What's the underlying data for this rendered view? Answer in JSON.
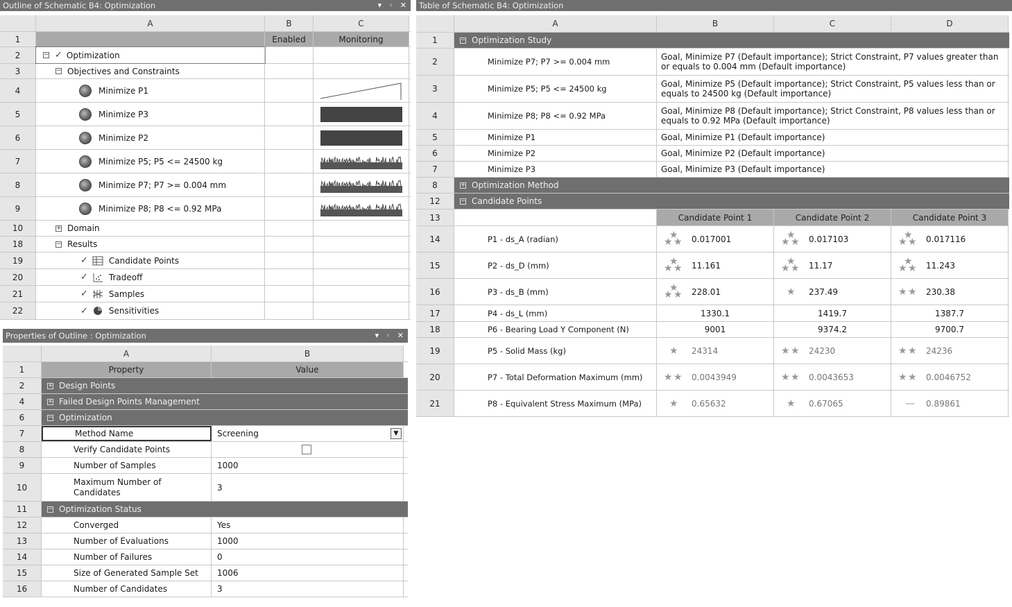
{
  "outline": {
    "title": "Outline of Schematic B4: Optimization",
    "controls": [
      "▾",
      "ᚲ",
      "✕"
    ],
    "col_headers": [
      "A",
      "B",
      "C"
    ],
    "subheaders": {
      "b": "Enabled",
      "c": "Monitoring"
    },
    "rows": [
      {
        "num": "1"
      },
      {
        "num": "2",
        "label": "Optimization",
        "toggle": "−",
        "check": "✓"
      },
      {
        "num": "3",
        "label": "Objectives and Constraints",
        "toggle": "−"
      },
      {
        "num": "4",
        "label": "Minimize P1",
        "spark": "line"
      },
      {
        "num": "5",
        "label": "Minimize P3",
        "spark": "dense"
      },
      {
        "num": "6",
        "label": "Minimize P2",
        "spark": "dense"
      },
      {
        "num": "7",
        "label": "Minimize P5; P5 <= 24500 kg",
        "spark": "noisy"
      },
      {
        "num": "8",
        "label": "Minimize P7; P7 >= 0.004 mm",
        "spark": "noisy"
      },
      {
        "num": "9",
        "label": "Minimize P8; P8 <= 0.92 MPa",
        "spark": "noisy"
      },
      {
        "num": "10",
        "label": "Domain",
        "toggle": "+"
      },
      {
        "num": "18",
        "label": "Results",
        "toggle": "−"
      },
      {
        "num": "19",
        "label": "Candidate Points",
        "check": "✓",
        "icon": "table-icon"
      },
      {
        "num": "20",
        "label": "Tradeoff",
        "check": "✓",
        "icon": "scatter-icon"
      },
      {
        "num": "21",
        "label": "Samples",
        "check": "✓",
        "icon": "samples-icon"
      },
      {
        "num": "22",
        "label": "Sensitivities",
        "check": "✓",
        "icon": "sensitivity-icon"
      }
    ]
  },
  "properties": {
    "title": "Properties of Outline : Optimization",
    "controls": [
      "▾",
      "ᚲ",
      "✕"
    ],
    "col_headers": [
      "A",
      "B"
    ],
    "subheaders": {
      "a": "Property",
      "b": "Value"
    },
    "rows": [
      {
        "num": "2",
        "section": true,
        "toggle": "+",
        "label": "Design Points"
      },
      {
        "num": "4",
        "section": true,
        "toggle": "+",
        "label": "Failed Design Points Management"
      },
      {
        "num": "6",
        "section": true,
        "toggle": "−",
        "label": "Optimization"
      },
      {
        "num": "7",
        "label": "Method Name",
        "value": "Screening",
        "dropdown": true
      },
      {
        "num": "8",
        "label": "Verify Candidate Points",
        "value": "",
        "checkbox": true
      },
      {
        "num": "9",
        "label": "Number of Samples",
        "value": "1000"
      },
      {
        "num": "10",
        "label": "Maximum Number of Candidates",
        "value": "3",
        "tall": true
      },
      {
        "num": "11",
        "section": true,
        "toggle": "−",
        "label": "Optimization Status"
      },
      {
        "num": "12",
        "label": "Converged",
        "value": "Yes"
      },
      {
        "num": "13",
        "label": "Number of Evaluations",
        "value": "1000"
      },
      {
        "num": "14",
        "label": "Number of Failures",
        "value": "0"
      },
      {
        "num": "15",
        "label": "Size of Generated Sample Set",
        "value": "1006"
      },
      {
        "num": "16",
        "label": "Number of Candidates",
        "value": "3"
      }
    ]
  },
  "table": {
    "title": "Table of Schematic B4: Optimization",
    "col_headers": [
      "A",
      "B",
      "C",
      "D"
    ],
    "rows": [
      {
        "num": "1",
        "section": true,
        "toggle": "−",
        "label": "Optimization Study"
      },
      {
        "num": "2",
        "label": "Minimize P7; P7 >= 0.004 mm",
        "desc": "Goal, Minimize P7 (Default importance); Strict Constraint, P7 values greater than or equals to 0.004 mm (Default importance)"
      },
      {
        "num": "3",
        "label": "Minimize P5; P5 <= 24500 kg",
        "desc": "Goal, Minimize P5 (Default importance); Strict Constraint, P5 values less than or equals to 24500 kg (Default importance)"
      },
      {
        "num": "4",
        "label": "Minimize P8; P8 <= 0.92 MPa",
        "desc": "Goal, Minimize P8 (Default importance); Strict Constraint, P8 values less than or equals to 0.92 MPa (Default importance)"
      },
      {
        "num": "5",
        "label": "Minimize P1",
        "desc": "Goal, Minimize P1 (Default importance)"
      },
      {
        "num": "6",
        "label": "Minimize P2",
        "desc": "Goal, Minimize P2 (Default importance)"
      },
      {
        "num": "7",
        "label": "Minimize P3",
        "desc": "Goal, Minimize P3 (Default importance)"
      },
      {
        "num": "8",
        "section": true,
        "toggle": "+",
        "label": "Optimization Method"
      },
      {
        "num": "12",
        "section": true,
        "toggle": "−",
        "label": "Candidate Points"
      },
      {
        "num": "13",
        "candidates": [
          "Candidate Point 1",
          "Candidate Point 2",
          "Candidate Point 3"
        ]
      },
      {
        "num": "14",
        "label": "P1 - ds_A (radian)",
        "vals": [
          "0.017001",
          "0.017103",
          "0.017116"
        ],
        "stars": [
          3,
          3,
          3
        ]
      },
      {
        "num": "15",
        "label": "P2 - ds_D (mm)",
        "vals": [
          "11.161",
          "11.17",
          "11.243"
        ],
        "stars": [
          3,
          3,
          3
        ]
      },
      {
        "num": "16",
        "label": "P3 - ds_B (mm)",
        "vals": [
          "228.01",
          "237.49",
          "230.38"
        ],
        "stars": [
          3,
          1,
          2
        ]
      },
      {
        "num": "17",
        "label": "P4 - ds_L (mm)",
        "vals": [
          "1330.1",
          "1419.7",
          "1387.7"
        ],
        "stars": [
          0,
          0,
          0
        ]
      },
      {
        "num": "18",
        "label": "P6 - Bearing Load Y Component (N)",
        "vals": [
          "9001",
          "9374.2",
          "9700.7"
        ],
        "stars": [
          0,
          0,
          0
        ]
      },
      {
        "num": "19",
        "label": "P5 - Solid Mass (kg)",
        "vals": [
          "24314",
          "24230",
          "24236"
        ],
        "stars": [
          1,
          2,
          2
        ]
      },
      {
        "num": "20",
        "label": "P7 - Total Deformation Maximum (mm)",
        "vals": [
          "0.0043949",
          "0.0043653",
          "0.0046752"
        ],
        "stars": [
          2,
          2,
          2
        ]
      },
      {
        "num": "21",
        "label": "P8 - Equivalent Stress Maximum (MPa)",
        "vals": [
          "0.65632",
          "0.67065",
          "0.89861"
        ],
        "stars": [
          1,
          1,
          -1
        ]
      }
    ]
  }
}
